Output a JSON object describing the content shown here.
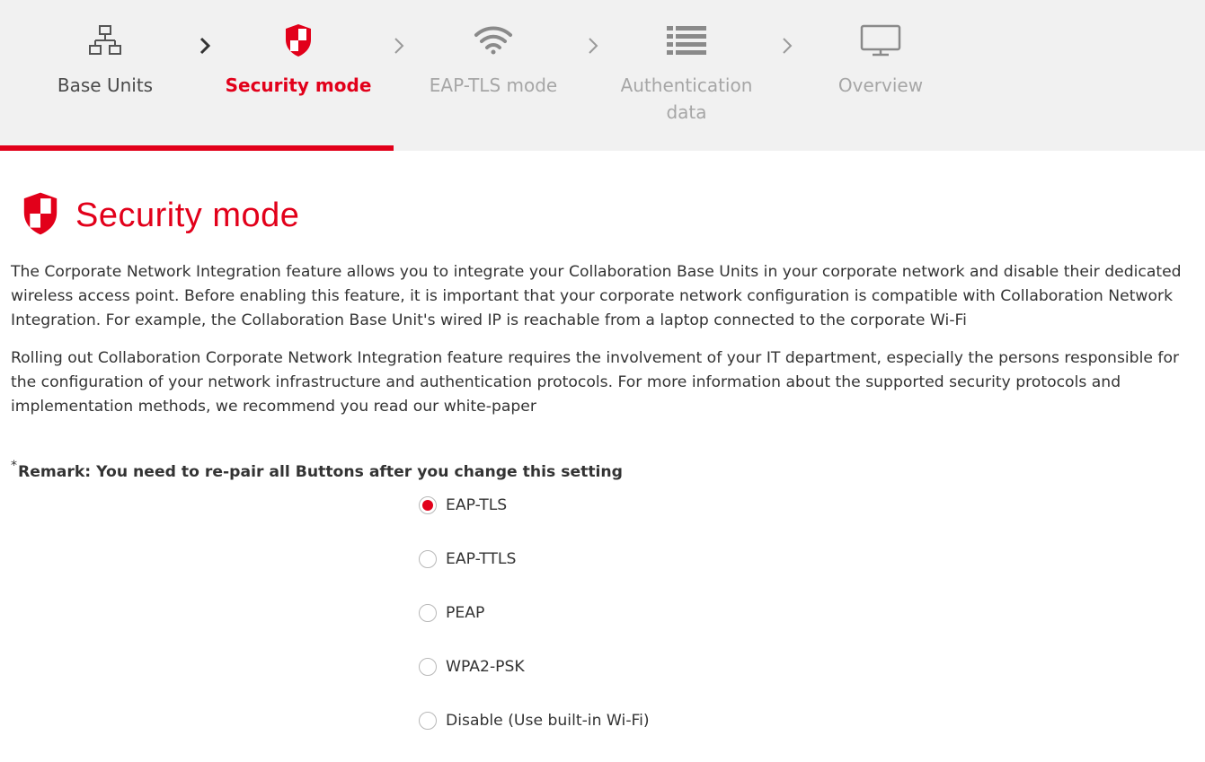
{
  "colors": {
    "accent": "#e2001a",
    "stepper_bg": "#f1f1f1",
    "text": "#333333",
    "muted": "#a6a6a6"
  },
  "stepper": {
    "steps": [
      {
        "label": "Base Units",
        "icon": "network-icon",
        "state": "done"
      },
      {
        "label": "Security mode",
        "icon": "shield-icon",
        "state": "active"
      },
      {
        "label": "EAP-TLS mode",
        "icon": "wifi-icon",
        "state": "pending"
      },
      {
        "label": "Authentication data",
        "icon": "list-icon",
        "state": "pending"
      },
      {
        "label": "Overview",
        "icon": "monitor-icon",
        "state": "pending"
      }
    ],
    "progress_fraction": 0.33
  },
  "page": {
    "title": "Security mode",
    "title_icon": "shield-icon",
    "paragraphs": [
      "The Corporate Network Integration feature allows you to integrate your Collaboration Base Units in your corporate network and disable their dedicated wireless access point. Before enabling this feature, it is important that your corporate network configuration is compatible with Collaboration Network Integration. For example, the Collaboration Base Unit's wired IP is reachable from a laptop connected to the corporate Wi-Fi",
      "Rolling out Collaboration Corporate Network Integration feature requires the involvement of your IT department, especially the persons responsible for the configuration of your network infrastructure and authentication protocols. For more information about the supported security protocols and implementation methods, we recommend you read our white-paper"
    ],
    "remark_star": "*",
    "remark": "Remark: You need to re-pair all Buttons after you change this setting"
  },
  "security_options": {
    "selected": "EAP-TLS",
    "options": [
      "EAP-TLS",
      "EAP-TTLS",
      "PEAP",
      "WPA2-PSK",
      "Disable (Use built-in Wi-Fi)"
    ]
  }
}
